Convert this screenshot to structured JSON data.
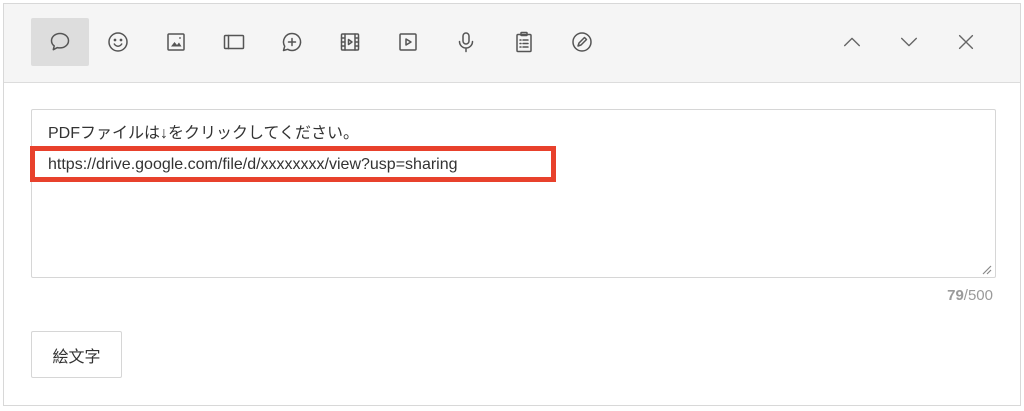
{
  "toolbar": {
    "tools": [
      {
        "name": "comment",
        "active": true
      },
      {
        "name": "emoji"
      },
      {
        "name": "image"
      },
      {
        "name": "frame"
      },
      {
        "name": "chat-add"
      },
      {
        "name": "video-file"
      },
      {
        "name": "video-play"
      },
      {
        "name": "microphone"
      },
      {
        "name": "clipboard-list"
      },
      {
        "name": "edit-pen"
      }
    ],
    "nav": [
      "chevron-up",
      "chevron-down",
      "close"
    ]
  },
  "editor": {
    "line1": "PDFファイルは↓をクリックしてください。",
    "line2": "https://drive.google.com/file/d/xxxxxxxx/view?usp=sharing",
    "highlight_color": "#e8412c"
  },
  "counter": {
    "current": "79",
    "max": "/500"
  },
  "emoji_button": {
    "label": "絵文字"
  }
}
